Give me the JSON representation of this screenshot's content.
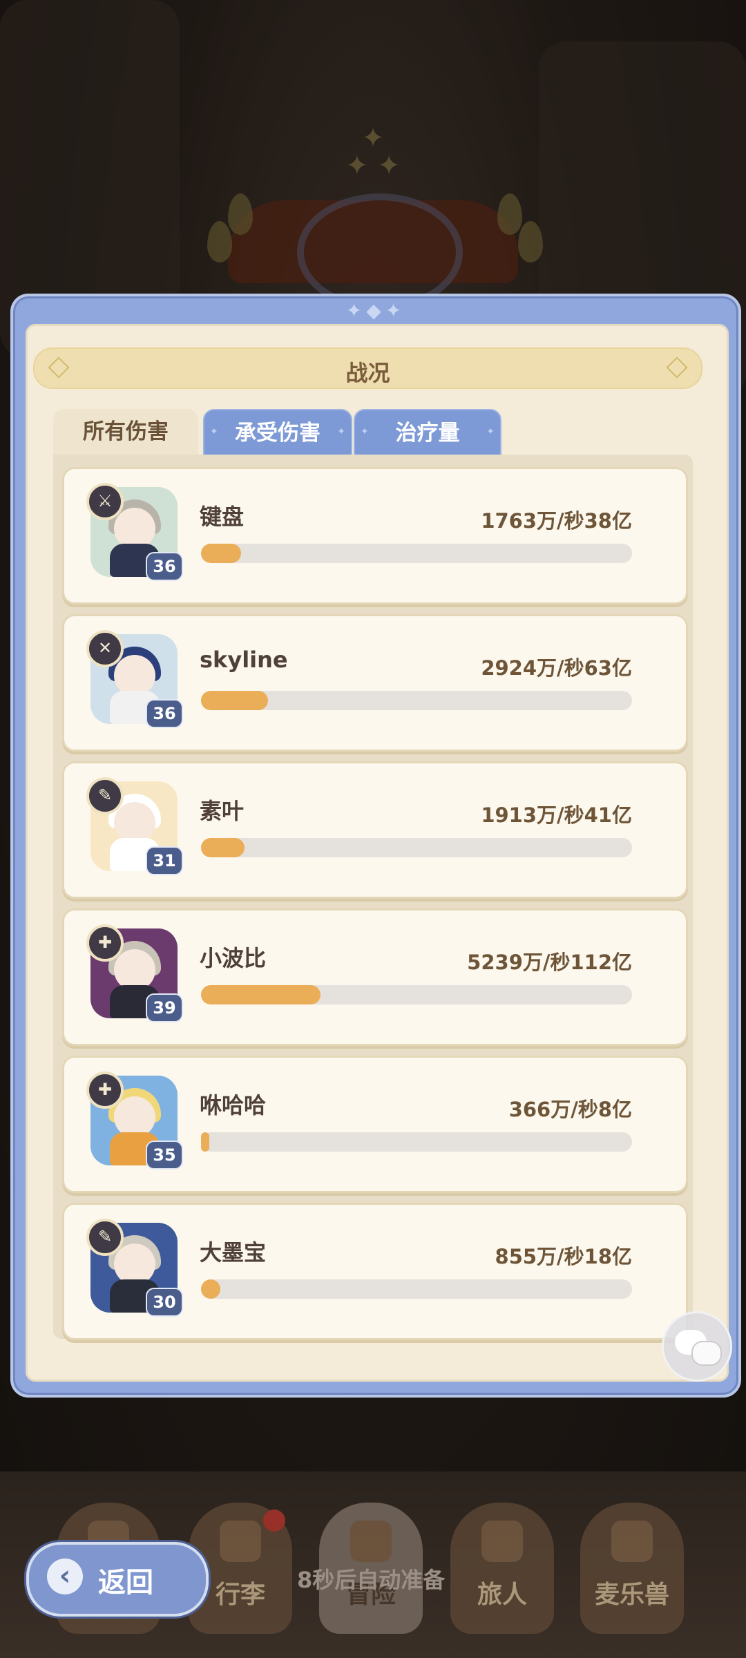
{
  "panel": {
    "title": "战况"
  },
  "tabs": [
    {
      "label": "所有伤害",
      "active": true
    },
    {
      "label": "承受伤害",
      "active": false
    },
    {
      "label": "治疗量",
      "active": false
    }
  ],
  "players": [
    {
      "name": "键盘",
      "level": "36",
      "stat": "1763万/秒38亿",
      "share": 0.093
    },
    {
      "name": "skyline",
      "level": "36",
      "stat": "2924万/秒63亿",
      "share": 0.155
    },
    {
      "name": "素叶",
      "level": "31",
      "stat": "1913万/秒41亿",
      "share": 0.101
    },
    {
      "name": "小波比",
      "level": "39",
      "stat": "5239万/秒112亿",
      "share": 0.277
    },
    {
      "name": "咻哈哈",
      "level": "35",
      "stat": "366万/秒8亿",
      "share": 0.019
    },
    {
      "name": "大墨宝",
      "level": "30",
      "stat": "855万/秒18亿",
      "share": 0.045
    }
  ],
  "avatar_colors": [
    {
      "bg": "#cfe0d5",
      "hair": "#b9b4aa",
      "body": "#2e3550",
      "badge": "⚔"
    },
    {
      "bg": "#cfe0ea",
      "hair": "#2b3f7b",
      "body": "#f1f1f1",
      "badge": "✕"
    },
    {
      "bg": "#f8e7c4",
      "hair": "#ffffff",
      "body": "#ffffff",
      "badge": "✎"
    },
    {
      "bg": "#6b3b6e",
      "hair": "#c8c3b6",
      "body": "#2a2a36",
      "badge": "✚"
    },
    {
      "bg": "#7fb2e0",
      "hair": "#f0d77a",
      "body": "#e8a040",
      "badge": "✚"
    },
    {
      "bg": "#3f5a9a",
      "hair": "#cfcac0",
      "body": "#2a2e3b",
      "badge": "✎"
    }
  ],
  "bottom_nav": {
    "items": [
      {
        "label": "",
        "active": false
      },
      {
        "label": "行李",
        "active": false,
        "alert": true
      },
      {
        "label": "冒险",
        "active": true
      },
      {
        "label": "旅人",
        "active": false
      },
      {
        "label": "麦乐兽",
        "active": false
      }
    ],
    "countdown": "8秒后自动准备"
  },
  "back_button": {
    "label": "返回"
  },
  "colors": {
    "accent": "#8fa7dc",
    "bar": "#ebae58",
    "panel_bg": "#f4ecd9"
  }
}
